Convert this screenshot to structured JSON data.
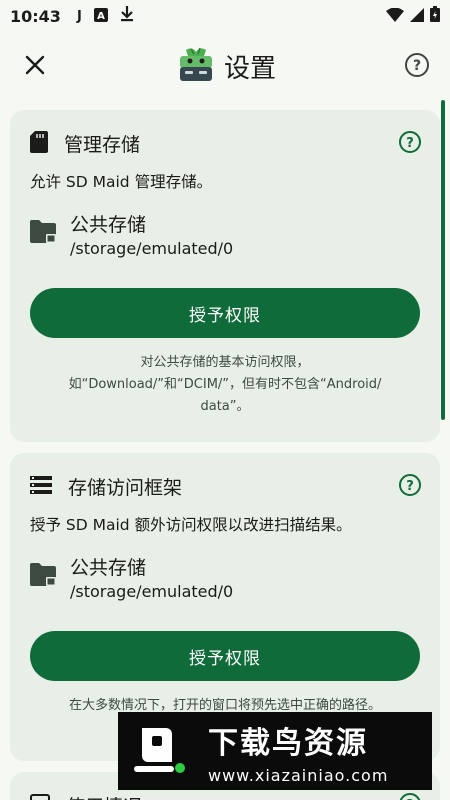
{
  "status_bar": {
    "time": "10:43"
  },
  "header": {
    "title": "设置"
  },
  "card_manage_storage": {
    "title": "管理存储",
    "description": "允许 SD Maid 管理存储。",
    "storage_name": "公共存储",
    "storage_path": "/storage/emulated/0",
    "button_label": "授予权限",
    "hint_line1": "对公共存储的基本访问权限，",
    "hint_line2": "如“Download/”和“DCIM/”，但有时不包含“Android/",
    "hint_line3": "data”。"
  },
  "card_saf": {
    "title": "存储访问框架",
    "description": "授予 SD Maid 额外访问权限以改进扫描结果。",
    "storage_name": "公共存储",
    "storage_path": "/storage/emulated/0",
    "button_label": "授予权限",
    "hint_line1": "在大多数情况下，打开的窗口将预先选中正确的路径。"
  },
  "card_usage": {
    "title": "使用情况"
  },
  "watermark": {
    "title": "下载鸟资源",
    "url": "www.xiazainiao.com"
  },
  "colors": {
    "accent": "#0f6b3a",
    "card_bg": "#e8efe6",
    "page_bg": "#f6f9f3"
  }
}
